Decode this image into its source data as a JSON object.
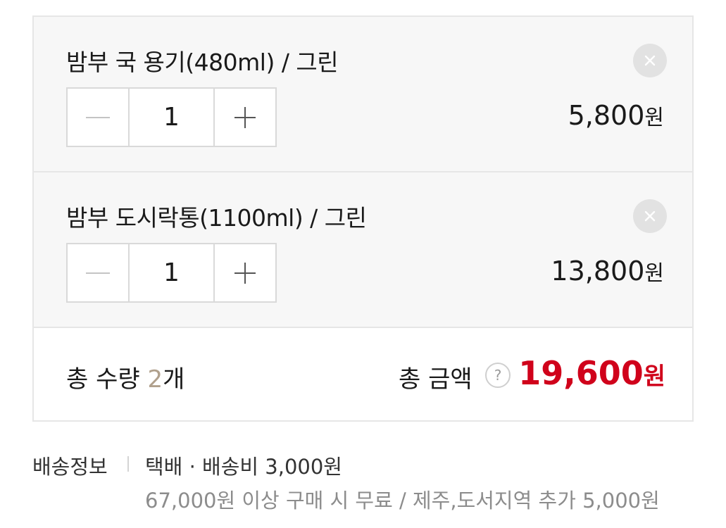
{
  "items": [
    {
      "name": "밤부 국 용기(480ml) / 그린",
      "quantity": "1",
      "price": "5,800",
      "currency": "원"
    },
    {
      "name": "밤부 도시락통(1100ml) / 그린",
      "quantity": "1",
      "price": "13,800",
      "currency": "원"
    }
  ],
  "summary": {
    "qty_label": "총 수량",
    "qty_value": "2",
    "qty_unit": "개",
    "amount_label": "총 금액",
    "help_symbol": "?",
    "amount_value": "19,600",
    "amount_currency": "원"
  },
  "shipping": {
    "label": "배송정보",
    "method": "택배 · 배송비 3,000원",
    "note": "67,000원 이상 구매 시 무료 / 제주,도서지역 추가 5,000원"
  },
  "colors": {
    "accent_red": "#d0021b",
    "qty_highlight": "#b0a08c",
    "panel_bg": "#f7f7f7",
    "border": "#e6e6e6"
  },
  "icons": {
    "remove": "close-icon",
    "decrease": "minus-icon",
    "increase": "plus-icon",
    "help": "help-icon"
  }
}
